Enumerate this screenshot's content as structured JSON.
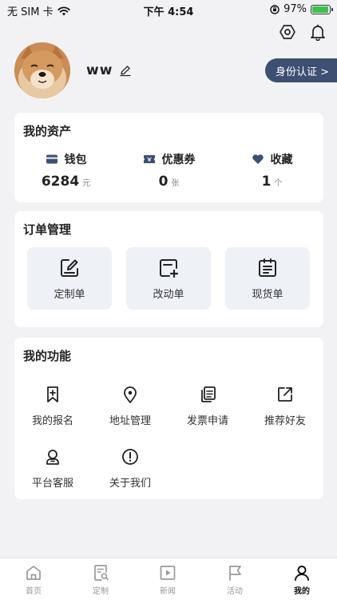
{
  "status_bar": {
    "carrier": "无 SIM 卡",
    "time": "下午 4:54",
    "battery": "97%",
    "battery_level": 0.97
  },
  "header": {
    "icons": [
      "settings-icon",
      "notification-bell-icon"
    ]
  },
  "profile": {
    "username": "ww",
    "verify_label": "身份认证 >"
  },
  "assets": {
    "title": "我的资产",
    "items": [
      {
        "label": "钱包",
        "value": "6284",
        "unit": "元",
        "icon": "wallet-icon",
        "color": "#3d4f73"
      },
      {
        "label": "优惠券",
        "value": "0",
        "unit": "张",
        "icon": "coupon-icon",
        "color": "#3d4f73"
      },
      {
        "label": "收藏",
        "value": "1",
        "unit": "个",
        "icon": "heart-icon",
        "color": "#3d4f73"
      }
    ]
  },
  "orders": {
    "title": "订单管理",
    "items": [
      {
        "label": "定制单",
        "icon": "edit-icon"
      },
      {
        "label": "改动单",
        "icon": "add-document-icon"
      },
      {
        "label": "现货单",
        "icon": "clipboard-icon"
      }
    ]
  },
  "functions": {
    "title": "我的功能",
    "items": [
      {
        "label": "我的报名",
        "icon": "bookmark-add-icon"
      },
      {
        "label": "地址管理",
        "icon": "location-pin-icon"
      },
      {
        "label": "发票申请",
        "icon": "invoice-icon"
      },
      {
        "label": "推荐好友",
        "icon": "share-icon"
      },
      {
        "label": "平台客服",
        "icon": "customer-service-icon"
      },
      {
        "label": "关于我们",
        "icon": "info-icon"
      }
    ]
  },
  "tabs": [
    {
      "label": "首页",
      "icon": "home-icon",
      "active": false
    },
    {
      "label": "定制",
      "icon": "custom-order-icon",
      "active": false
    },
    {
      "label": "新闻",
      "icon": "video-play-icon",
      "active": false
    },
    {
      "label": "活动",
      "icon": "flag-icon",
      "active": false
    },
    {
      "label": "我的",
      "icon": "user-icon",
      "active": true
    }
  ],
  "colors": {
    "accent": "#3d4f73",
    "background": "#f2f2f4",
    "card": "#ffffff",
    "order_button_bg": "#eef1f6",
    "battery_green": "#3ac24a"
  }
}
